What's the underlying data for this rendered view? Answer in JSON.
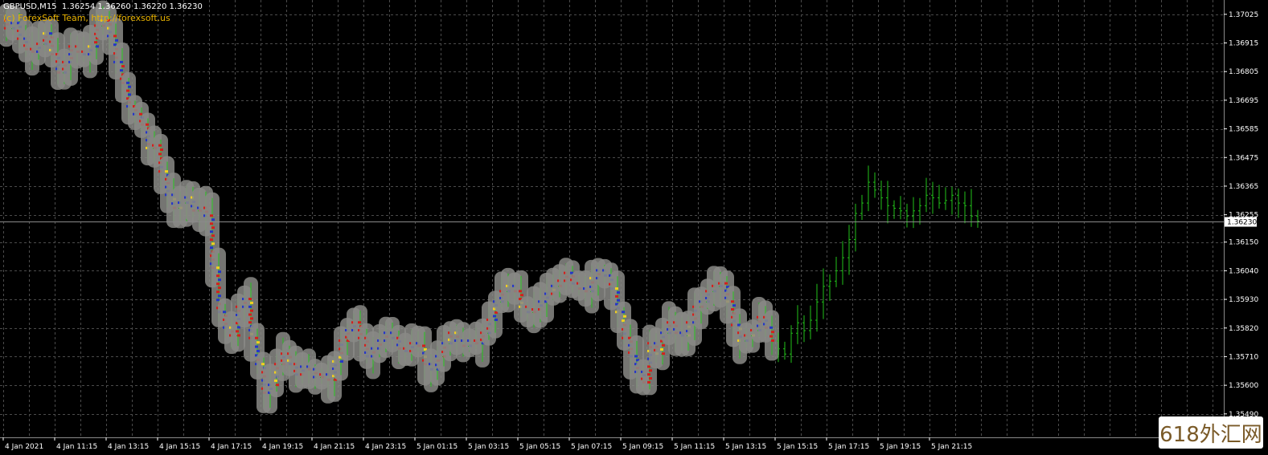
{
  "header": {
    "symbol_line": "GBPUSD,M15  1.36254 1.36260 1.36220 1.36230",
    "credit_line": "(c) ForexSoft Team, http://forexsoft.us"
  },
  "watermark": "618外汇网",
  "colors": {
    "background": "#000000",
    "grid": "#4b4b4b",
    "candle": "#22c21a",
    "halo": "#8a8a86",
    "marker_red": "#d4201c",
    "marker_blue": "#2436c8",
    "marker_yellow": "#f0d020",
    "axis_text": "#ffffff",
    "price_line": "#8a8a8a"
  },
  "chart_data": {
    "type": "candlestick",
    "title": "GBPUSD,M15",
    "quote": {
      "open": 1.36254,
      "high": 1.3626,
      "low": 1.3622,
      "close": 1.3623
    },
    "current_price": "1.36230",
    "current_price_value": 1.3623,
    "ylim": [
      1.354,
      1.3708
    ],
    "y_ticks": [
      "1.37025",
      "1.36915",
      "1.36805",
      "1.36695",
      "1.36585",
      "1.36475",
      "1.36365",
      "1.36255",
      "1.36150",
      "1.36040",
      "1.35930",
      "1.35820",
      "1.35710",
      "1.35600",
      "1.35490"
    ],
    "y_tick_values": [
      1.37025,
      1.36915,
      1.36805,
      1.36695,
      1.36585,
      1.36475,
      1.36365,
      1.36255,
      1.3615,
      1.3604,
      1.3593,
      1.3582,
      1.3571,
      1.356,
      1.3549
    ],
    "x_ticks": [
      "4 Jan 2021",
      "4 Jan 11:15",
      "4 Jan 13:15",
      "4 Jan 15:15",
      "4 Jan 17:15",
      "4 Jan 19:15",
      "4 Jan 21:15",
      "4 Jan 23:15",
      "5 Jan 01:15",
      "5 Jan 03:15",
      "5 Jan 05:15",
      "5 Jan 07:15",
      "5 Jan 09:15",
      "5 Jan 11:15",
      "5 Jan 13:15",
      "5 Jan 15:15",
      "5 Jan 17:15",
      "5 Jan 19:15",
      "5 Jan 21:15"
    ],
    "x_tick_bars": [
      0,
      8,
      16,
      24,
      32,
      40,
      48,
      56,
      64,
      72,
      80,
      88,
      96,
      104,
      112,
      120,
      128,
      136,
      144
    ],
    "grid": true,
    "series": [
      {
        "values": [
          1.3697,
          1.3699,
          1.3693,
          1.3689,
          1.3688,
          1.3691,
          1.3695,
          1.3687,
          1.368,
          1.3684,
          1.369,
          1.3688,
          1.3687,
          1.369,
          1.3698,
          1.37,
          1.3694,
          1.3684,
          1.3676,
          1.3667,
          1.3664,
          1.366,
          1.3651,
          1.3652,
          1.3642,
          1.3633,
          1.3628,
          1.363,
          1.3632,
          1.3627,
          1.3628,
          1.3625,
          1.3605,
          1.3588,
          1.3582,
          1.3579,
          1.359,
          1.3593,
          1.3578,
          1.3568,
          1.3557,
          1.356,
          1.3568,
          1.3572,
          1.3568,
          1.3564,
          1.3567,
          1.3566,
          1.3563,
          1.3564,
          1.3562,
          1.3569,
          1.3577,
          1.3581,
          1.3584,
          1.3578,
          1.3571,
          1.3574,
          1.3577,
          1.358,
          1.3578,
          1.3574,
          1.3573,
          1.3576,
          1.3575,
          1.3568,
          1.3566,
          1.3571,
          1.3576,
          1.358,
          1.3577,
          1.3575,
          1.3577,
          1.3576,
          1.358,
          1.3585,
          1.3592,
          1.3596,
          1.3598,
          1.3596,
          1.359,
          1.3588,
          1.3589,
          1.3592,
          1.3595,
          1.3598,
          1.36,
          1.3603,
          1.3599,
          1.3597,
          1.3596,
          1.3601,
          1.3604,
          1.3602,
          1.3597,
          1.3588,
          1.3578,
          1.3571,
          1.3565,
          1.3561,
          1.3576,
          1.3572,
          1.358,
          1.3584,
          1.358,
          1.3579,
          1.3584,
          1.359,
          1.3592,
          1.3596,
          1.3598,
          1.3599,
          1.3592,
          1.3583,
          1.3577,
          1.3579,
          1.3581,
          1.3586,
          1.3582,
          1.3577,
          1.3574,
          1.3572,
          1.358,
          1.3584,
          1.3581,
          1.3585,
          1.3592,
          1.3598,
          1.36,
          1.3604,
          1.3609,
          1.3616,
          1.3626,
          1.363,
          1.3638,
          1.3635,
          1.3632,
          1.3629,
          1.3628,
          1.3627,
          1.3625,
          1.3627,
          1.3629,
          1.3633,
          1.3632,
          1.363,
          1.3631,
          1.3633,
          1.363,
          1.3629,
          1.3625,
          1.3623
        ]
      }
    ]
  }
}
